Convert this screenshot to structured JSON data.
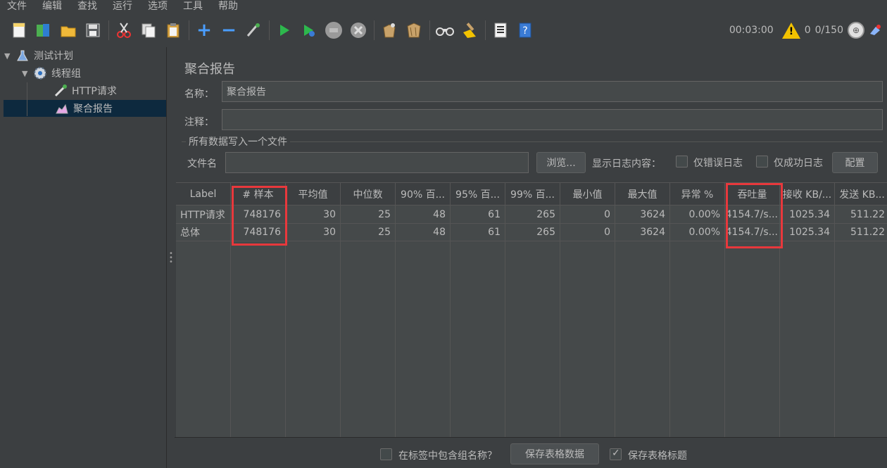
{
  "menu": [
    "文件",
    "编辑",
    "查找",
    "运行",
    "选项",
    "工具",
    "帮助"
  ],
  "toolbar": {
    "icons": [
      "new-icon",
      "templates-icon",
      "open-icon",
      "save-icon",
      "cut-icon",
      "copy-icon",
      "paste-icon",
      "expand-icon",
      "collapse-icon",
      "toggle-icon",
      "start-icon",
      "start-no-pause-icon",
      "stop-icon",
      "shutdown-icon",
      "clear-icon",
      "clear-all-icon",
      "search-icon",
      "reset-search-icon",
      "function-helper-icon",
      "help-icon"
    ],
    "timer": "00:03:00",
    "warning_count": "0",
    "threads": "0/150"
  },
  "tree": {
    "items": [
      {
        "label": "测试计划",
        "icon": "flask-icon"
      },
      {
        "label": "线程组",
        "icon": "gear-icon"
      },
      {
        "label": "HTTP请求",
        "icon": "pipette-icon"
      },
      {
        "label": "聚合报告",
        "icon": "chart-icon"
      }
    ]
  },
  "report": {
    "title": "聚合报告",
    "name_label": "名称：",
    "name_value": "聚合报告",
    "comment_label": "注释：",
    "comment_value": "",
    "group_title": "所有数据写入一个文件",
    "filename_label": "文件名",
    "filename_value": "",
    "browse_button": "浏览...",
    "log_content_label": "显示日志内容：",
    "errors_only_label": "仅错误日志",
    "success_only_label": "仅成功日志",
    "configure_button": "配置"
  },
  "table": {
    "headers": [
      "Label",
      "# 样本",
      "平均值",
      "中位数",
      "90% 百...",
      "95% 百...",
      "99% 百...",
      "最小值",
      "最大值",
      "异常 %",
      "吞吐量",
      "接收 KB/...",
      "发送 KB..."
    ],
    "rows": [
      [
        "HTTP请求",
        "748176",
        "30",
        "25",
        "48",
        "61",
        "265",
        "0",
        "3624",
        "0.00%",
        "4154.7/s...",
        "1025.34",
        "511.22"
      ],
      [
        "总体",
        "748176",
        "30",
        "25",
        "48",
        "61",
        "265",
        "0",
        "3624",
        "0.00%",
        "4154.7/s...",
        "1025.34",
        "511.22"
      ]
    ]
  },
  "bottom": {
    "include_group_label": "在标签中包含组名称？",
    "save_table_button": "保存表格数据",
    "save_header_label": "保存表格标题"
  },
  "colors": {
    "highlight": "#e8383c",
    "background": "#3c3f41",
    "selection": "#0d293e"
  }
}
